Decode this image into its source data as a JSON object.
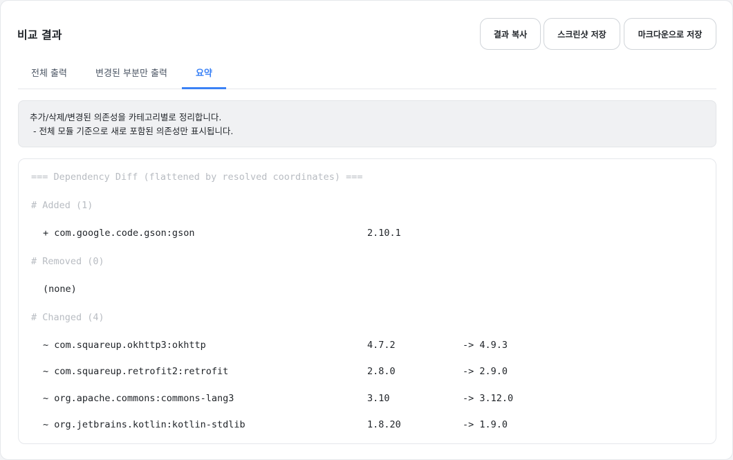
{
  "header": {
    "title": "비교 결과",
    "buttons": {
      "copy": "결과 복사",
      "screenshot": "스크린샷 저장",
      "markdown": "마크다운으로 저장"
    }
  },
  "tabs": [
    {
      "label": "전체 출력",
      "active": false
    },
    {
      "label": "변경된 부분만 출력",
      "active": false
    },
    {
      "label": "요약",
      "active": true
    }
  ],
  "info": {
    "line1": "추가/삭제/변경된 의존성을 카테고리별로 정리합니다.",
    "line2": "- 전체 모듈 기준으로 새로 포함된 의존성만 표시됩니다."
  },
  "diff": {
    "heading": "=== Dependency Diff (flattened by resolved coordinates) ===",
    "added": {
      "heading": "# Added (1)",
      "items": [
        {
          "name": "+ com.google.code.gson:gson",
          "version": "2.10.1"
        }
      ]
    },
    "removed": {
      "heading": "# Removed (0)",
      "none_text": "(none)"
    },
    "changed": {
      "heading": "# Changed (4)",
      "items": [
        {
          "name": "~ com.squareup.okhttp3:okhttp",
          "from": "4.7.2",
          "to": "-> 4.9.3"
        },
        {
          "name": "~ com.squareup.retrofit2:retrofit",
          "from": "2.8.0",
          "to": "-> 2.9.0"
        },
        {
          "name": "~ org.apache.commons:commons-lang3",
          "from": "3.10",
          "to": "-> 3.12.0"
        },
        {
          "name": "~ org.jetbrains.kotlin:kotlin-stdlib",
          "from": "1.8.20",
          "to": "-> 1.9.0"
        }
      ]
    }
  },
  "colors": {
    "accent": "#3b82f6",
    "dim_text": "#b8bcc2",
    "info_bg": "#f0f1f3"
  }
}
